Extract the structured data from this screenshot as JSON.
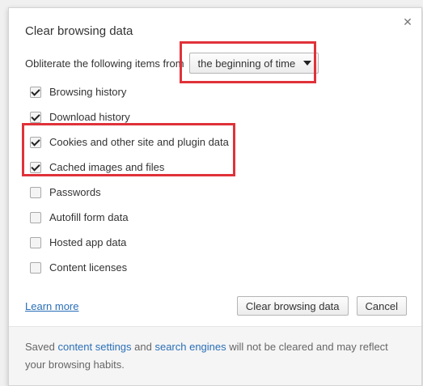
{
  "dialog": {
    "title": "Clear browsing data",
    "close_icon": "close-icon",
    "obliterate_label": "Obliterate the following items from",
    "time_range": {
      "selected": "the beginning of time"
    },
    "options": [
      {
        "label": "Browsing history",
        "checked": true
      },
      {
        "label": "Download history",
        "checked": true
      },
      {
        "label": "Cookies and other site and plugin data",
        "checked": true
      },
      {
        "label": "Cached images and files",
        "checked": true
      },
      {
        "label": "Passwords",
        "checked": false
      },
      {
        "label": "Autofill form data",
        "checked": false
      },
      {
        "label": "Hosted app data",
        "checked": false
      },
      {
        "label": "Content licenses",
        "checked": false
      }
    ],
    "learn_more": "Learn more",
    "clear_button": "Clear browsing data",
    "cancel_button": "Cancel",
    "note": {
      "before": "Saved ",
      "link1": "content settings",
      "middle": " and ",
      "link2": "search engines",
      "after": " will not be cleared and may reflect your browsing habits."
    }
  },
  "highlight_color": "#e0323a",
  "link_color": "#2a6fb7"
}
